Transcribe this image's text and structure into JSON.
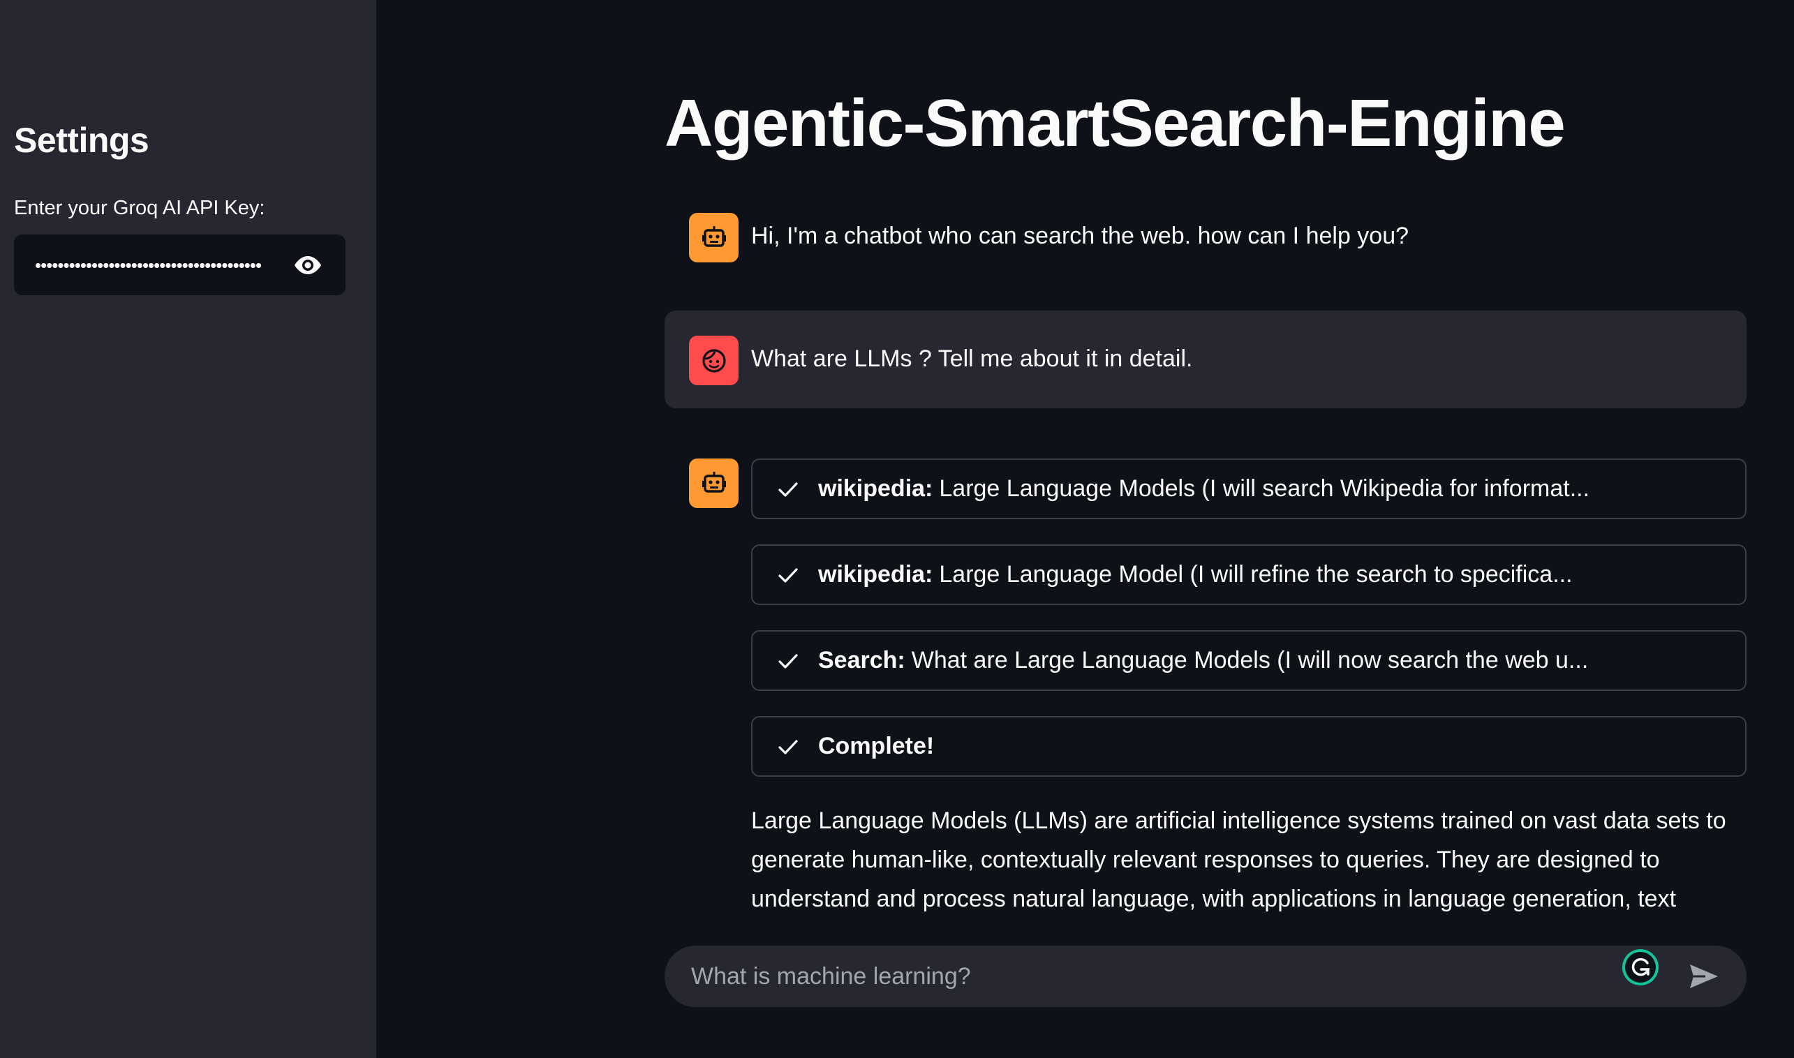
{
  "sidebar": {
    "title": "Settings",
    "api_key_label": "Enter your Groq AI API Key:",
    "api_key_masked": "••••••••••••••••••••••••••••••••••••••••"
  },
  "main": {
    "title": "Agentic-SmartSearch-Engine"
  },
  "messages": [
    {
      "role": "assistant",
      "text": "Hi, I'm a chatbot who can search the web. how can I help you?"
    },
    {
      "role": "user",
      "text": "What are LLMs ? Tell me about it in detail."
    }
  ],
  "steps": [
    {
      "tool": "wikipedia:",
      "text": "Large Language Models (I will search Wikipedia for informat..."
    },
    {
      "tool": "wikipedia:",
      "text": "Large Language Model (I will refine the search to specifica..."
    },
    {
      "tool": "Search:",
      "text": "What are Large Language Models (I will now search the web u..."
    },
    {
      "tool": "Complete!",
      "text": ""
    }
  ],
  "answer": "Large Language Models (LLMs) are artificial intelligence systems trained on vast data sets to generate human-like, contextually relevant responses to queries. They are designed to understand and process natural language, with applications in language generation, text",
  "chat_input": {
    "placeholder": "What is machine learning?"
  },
  "colors": {
    "background": "#0e1117",
    "sidebar": "#262730",
    "assistant_avatar": "#ff9a32",
    "user_avatar": "#ff4b4b"
  },
  "icons": {
    "eye": "eye-icon",
    "assistant": "robot-icon",
    "user": "face-icon",
    "check": "check-icon",
    "send": "send-icon",
    "grammarly": "grammarly-icon"
  }
}
